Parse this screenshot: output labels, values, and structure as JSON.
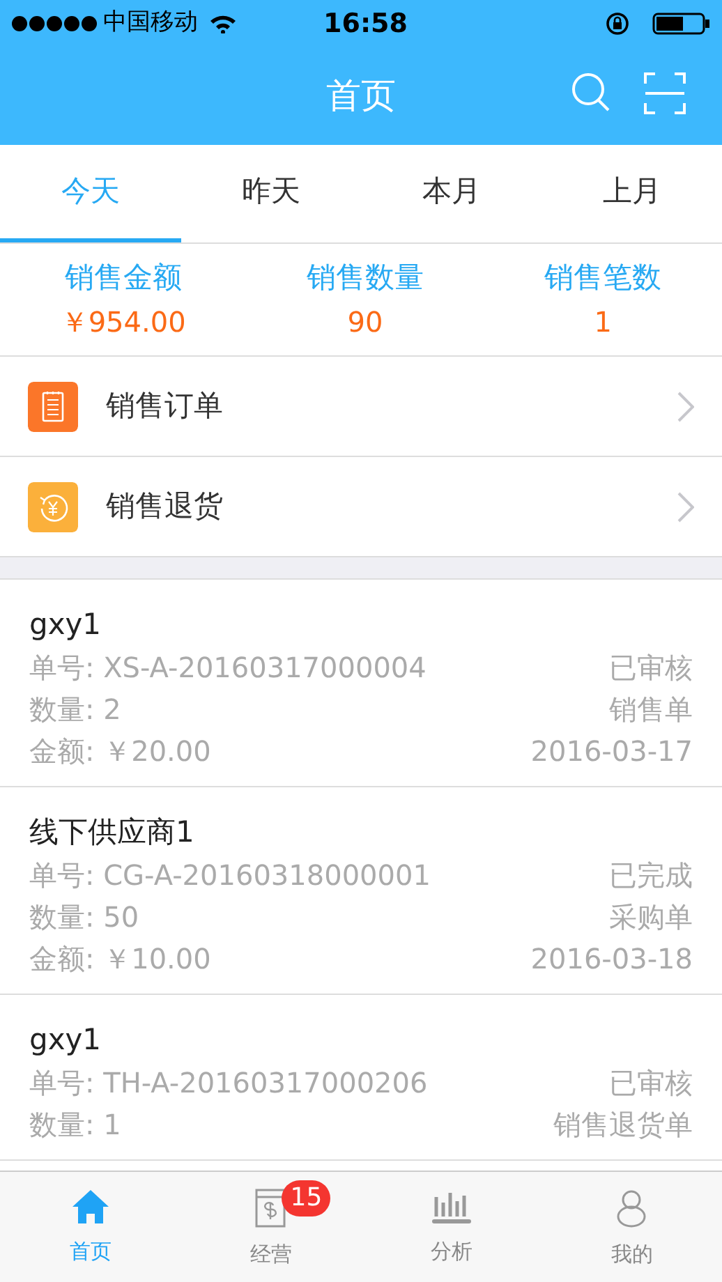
{
  "status_bar": {
    "carrier": "中国移动",
    "time": "16:58"
  },
  "header": {
    "title": "首页"
  },
  "tabs": [
    {
      "label": "今天",
      "selected": true
    },
    {
      "label": "昨天",
      "selected": false
    },
    {
      "label": "本月",
      "selected": false
    },
    {
      "label": "上月",
      "selected": false
    }
  ],
  "stats": [
    {
      "label": "销售金额",
      "value": "￥954.00"
    },
    {
      "label": "销售数量",
      "value": "90"
    },
    {
      "label": "销售笔数",
      "value": "1"
    }
  ],
  "menu": [
    {
      "kind": "order",
      "label": "销售订单",
      "color": "#fb7629"
    },
    {
      "kind": "return",
      "label": "销售退货",
      "color": "#fbb03b"
    }
  ],
  "orders": [
    {
      "name": "gxy1",
      "lines": [
        [
          "单号: XS-A-20160317000004",
          "已审核"
        ],
        [
          "数量: 2",
          "销售单"
        ],
        [
          "金额: ￥20.00",
          "2016-03-17"
        ]
      ]
    },
    {
      "name": "线下供应商1",
      "lines": [
        [
          "单号: CG-A-20160318000001",
          "已完成"
        ],
        [
          "数量: 50",
          "采购单"
        ],
        [
          "金额: ￥10.00",
          "2016-03-18"
        ]
      ]
    },
    {
      "name": "gxy1",
      "lines": [
        [
          "单号: TH-A-20160317000206",
          "已审核"
        ],
        [
          "数量: 1",
          "销售退货单"
        ]
      ]
    }
  ],
  "tab_bar": [
    {
      "kind": "home",
      "label": "首页",
      "selected": true
    },
    {
      "kind": "business",
      "label": "经营",
      "selected": false,
      "badge": "15"
    },
    {
      "kind": "analysis",
      "label": "分析",
      "selected": false
    },
    {
      "kind": "profile",
      "label": "我的",
      "selected": false
    }
  ]
}
